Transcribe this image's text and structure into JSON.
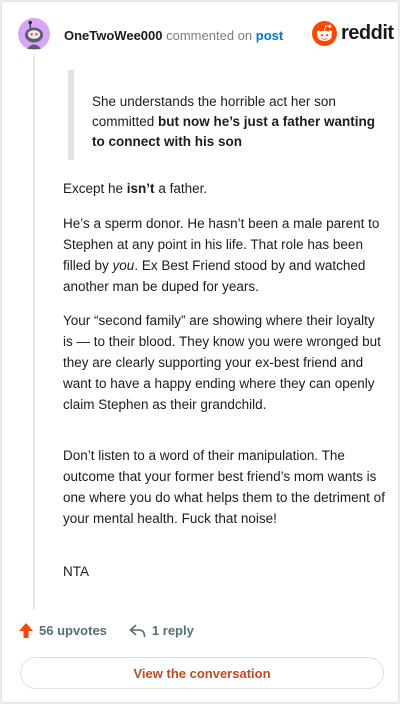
{
  "header": {
    "username": "OneTwoWee000",
    "action": "commented on",
    "target": "post"
  },
  "brand": {
    "wordmark": "reddit",
    "logo_icon": "reddit-logo-icon",
    "accent_color": "#ff4500"
  },
  "quote": {
    "plain": "She understands the horrible act her son committed ",
    "bold": "but now he’s just a father wanting to connect with his son"
  },
  "paragraphs": {
    "p1_before": "Except he ",
    "p1_bold": "isn’t",
    "p1_after": " a father.",
    "p2_before": "He’s a sperm donor. He hasn’t been a male parent to Stephen at any point in his life. That role has been filled by ",
    "p2_italic": "you",
    "p2_after": ". Ex Best Friend stood by and watched another man be duped for years.",
    "p3": "Your “second family” are showing where their loyalty is — to their blood. They know you were wronged but they are clearly supporting your ex-best friend and want to have a happy ending where they can openly claim Stephen as their grandchild.",
    "p4": "Don’t listen to a word of their manipulation. The outcome that your former best friend’s mom wants is one where you do what helps them to the detriment of your mental health. Fuck that noise!",
    "p5": "NTA"
  },
  "footer": {
    "upvotes": "56 upvotes",
    "replies": "1 reply",
    "upvote_icon": "upvote-arrow-icon",
    "reply_icon": "reply-arrow-icon"
  },
  "cta": {
    "label": "View the conversation"
  }
}
